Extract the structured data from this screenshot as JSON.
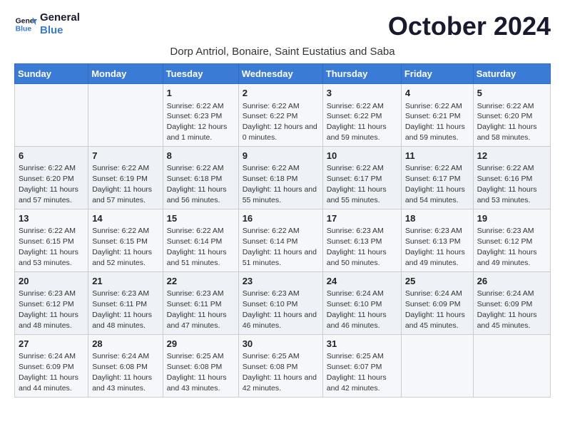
{
  "logo": {
    "line1": "General",
    "line2": "Blue"
  },
  "title": "October 2024",
  "subtitle": "Dorp Antriol, Bonaire, Saint Eustatius and Saba",
  "days_of_week": [
    "Sunday",
    "Monday",
    "Tuesday",
    "Wednesday",
    "Thursday",
    "Friday",
    "Saturday"
  ],
  "weeks": [
    [
      {
        "day": "",
        "info": ""
      },
      {
        "day": "",
        "info": ""
      },
      {
        "day": "1",
        "info": "Sunrise: 6:22 AM\nSunset: 6:23 PM\nDaylight: 12 hours and 1 minute."
      },
      {
        "day": "2",
        "info": "Sunrise: 6:22 AM\nSunset: 6:22 PM\nDaylight: 12 hours and 0 minutes."
      },
      {
        "day": "3",
        "info": "Sunrise: 6:22 AM\nSunset: 6:22 PM\nDaylight: 11 hours and 59 minutes."
      },
      {
        "day": "4",
        "info": "Sunrise: 6:22 AM\nSunset: 6:21 PM\nDaylight: 11 hours and 59 minutes."
      },
      {
        "day": "5",
        "info": "Sunrise: 6:22 AM\nSunset: 6:20 PM\nDaylight: 11 hours and 58 minutes."
      }
    ],
    [
      {
        "day": "6",
        "info": "Sunrise: 6:22 AM\nSunset: 6:20 PM\nDaylight: 11 hours and 57 minutes."
      },
      {
        "day": "7",
        "info": "Sunrise: 6:22 AM\nSunset: 6:19 PM\nDaylight: 11 hours and 57 minutes."
      },
      {
        "day": "8",
        "info": "Sunrise: 6:22 AM\nSunset: 6:18 PM\nDaylight: 11 hours and 56 minutes."
      },
      {
        "day": "9",
        "info": "Sunrise: 6:22 AM\nSunset: 6:18 PM\nDaylight: 11 hours and 55 minutes."
      },
      {
        "day": "10",
        "info": "Sunrise: 6:22 AM\nSunset: 6:17 PM\nDaylight: 11 hours and 55 minutes."
      },
      {
        "day": "11",
        "info": "Sunrise: 6:22 AM\nSunset: 6:17 PM\nDaylight: 11 hours and 54 minutes."
      },
      {
        "day": "12",
        "info": "Sunrise: 6:22 AM\nSunset: 6:16 PM\nDaylight: 11 hours and 53 minutes."
      }
    ],
    [
      {
        "day": "13",
        "info": "Sunrise: 6:22 AM\nSunset: 6:15 PM\nDaylight: 11 hours and 53 minutes."
      },
      {
        "day": "14",
        "info": "Sunrise: 6:22 AM\nSunset: 6:15 PM\nDaylight: 11 hours and 52 minutes."
      },
      {
        "day": "15",
        "info": "Sunrise: 6:22 AM\nSunset: 6:14 PM\nDaylight: 11 hours and 51 minutes."
      },
      {
        "day": "16",
        "info": "Sunrise: 6:22 AM\nSunset: 6:14 PM\nDaylight: 11 hours and 51 minutes."
      },
      {
        "day": "17",
        "info": "Sunrise: 6:23 AM\nSunset: 6:13 PM\nDaylight: 11 hours and 50 minutes."
      },
      {
        "day": "18",
        "info": "Sunrise: 6:23 AM\nSunset: 6:13 PM\nDaylight: 11 hours and 49 minutes."
      },
      {
        "day": "19",
        "info": "Sunrise: 6:23 AM\nSunset: 6:12 PM\nDaylight: 11 hours and 49 minutes."
      }
    ],
    [
      {
        "day": "20",
        "info": "Sunrise: 6:23 AM\nSunset: 6:12 PM\nDaylight: 11 hours and 48 minutes."
      },
      {
        "day": "21",
        "info": "Sunrise: 6:23 AM\nSunset: 6:11 PM\nDaylight: 11 hours and 48 minutes."
      },
      {
        "day": "22",
        "info": "Sunrise: 6:23 AM\nSunset: 6:11 PM\nDaylight: 11 hours and 47 minutes."
      },
      {
        "day": "23",
        "info": "Sunrise: 6:23 AM\nSunset: 6:10 PM\nDaylight: 11 hours and 46 minutes."
      },
      {
        "day": "24",
        "info": "Sunrise: 6:24 AM\nSunset: 6:10 PM\nDaylight: 11 hours and 46 minutes."
      },
      {
        "day": "25",
        "info": "Sunrise: 6:24 AM\nSunset: 6:09 PM\nDaylight: 11 hours and 45 minutes."
      },
      {
        "day": "26",
        "info": "Sunrise: 6:24 AM\nSunset: 6:09 PM\nDaylight: 11 hours and 45 minutes."
      }
    ],
    [
      {
        "day": "27",
        "info": "Sunrise: 6:24 AM\nSunset: 6:09 PM\nDaylight: 11 hours and 44 minutes."
      },
      {
        "day": "28",
        "info": "Sunrise: 6:24 AM\nSunset: 6:08 PM\nDaylight: 11 hours and 43 minutes."
      },
      {
        "day": "29",
        "info": "Sunrise: 6:25 AM\nSunset: 6:08 PM\nDaylight: 11 hours and 43 minutes."
      },
      {
        "day": "30",
        "info": "Sunrise: 6:25 AM\nSunset: 6:08 PM\nDaylight: 11 hours and 42 minutes."
      },
      {
        "day": "31",
        "info": "Sunrise: 6:25 AM\nSunset: 6:07 PM\nDaylight: 11 hours and 42 minutes."
      },
      {
        "day": "",
        "info": ""
      },
      {
        "day": "",
        "info": ""
      }
    ]
  ]
}
